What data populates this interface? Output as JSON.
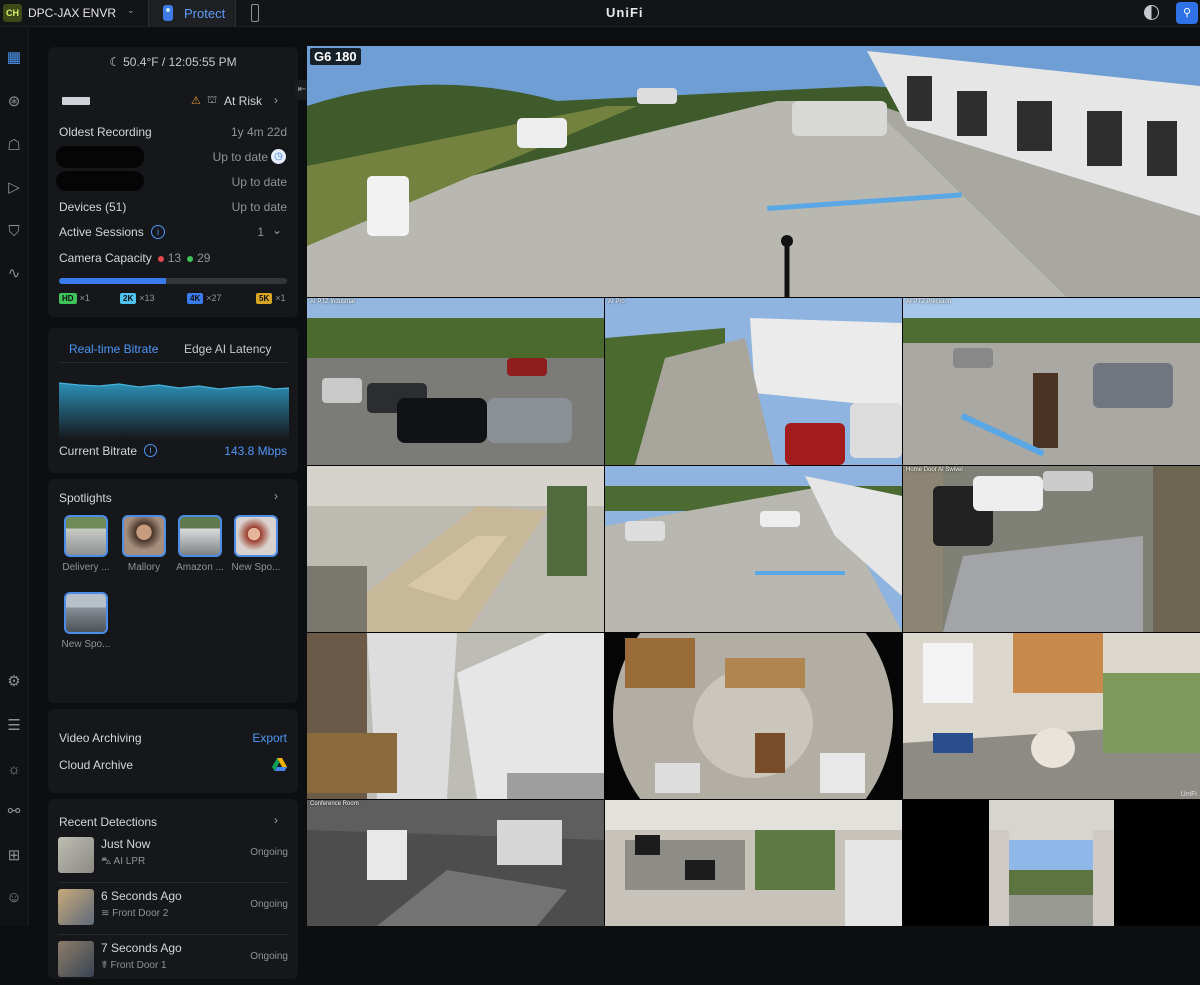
{
  "topbar": {
    "site_badge": "CH",
    "site_name": "DPC-JAX ENVR",
    "app_tab": "Protect",
    "logo": "UniFi"
  },
  "status": {
    "weather": "50.4°F / 12:05:55 PM",
    "risk_label": "At Risk",
    "rows": [
      {
        "label": "Oldest Recording",
        "value": "1y 4m 22d"
      },
      {
        "label": "",
        "value": "Up to date"
      },
      {
        "label": "",
        "value": "Up to date"
      },
      {
        "label": "Devices (51)",
        "value": "Up to date"
      },
      {
        "label": "Active Sessions",
        "value": "1"
      }
    ],
    "capacity_label": "Camera Capacity",
    "capacity_red": "13",
    "capacity_green": "29",
    "capacity_fraction": 0.47,
    "resolutions": [
      {
        "tag": "HD",
        "count": "×1",
        "color": "#3ec25a"
      },
      {
        "tag": "2K",
        "count": "×13",
        "color": "#4fc3f0"
      },
      {
        "tag": "4K",
        "count": "×27",
        "color": "#3a7bed"
      },
      {
        "tag": "5K",
        "count": "×1",
        "color": "#d9a520"
      }
    ]
  },
  "bitrate": {
    "tab_active": "Real-time Bitrate",
    "tab_other": "Edge AI Latency",
    "label": "Current Bitrate",
    "value": "143.8 Mbps"
  },
  "spotlights": {
    "title": "Spotlights",
    "items": [
      "Delivery ...",
      "Mallory",
      "Amazon ...",
      "New Spo...",
      "New Spo..."
    ]
  },
  "archive": {
    "video_archiving": "Video Archiving",
    "export": "Export",
    "cloud_archive": "Cloud Archive"
  },
  "detections": {
    "title": "Recent Detections",
    "items": [
      {
        "time": "Just Now",
        "source": "AI LPR",
        "status": "Ongoing"
      },
      {
        "time": "6 Seconds Ago",
        "source": "Front Door 2",
        "status": "Ongoing"
      },
      {
        "time": "7 Seconds Ago",
        "source": "Front Door 1",
        "status": "Ongoing"
      }
    ]
  },
  "cameras": {
    "main": "G6 180",
    "tiles": [
      "AI PTZ Industrial",
      "AI Pro",
      "AI PTZ Precision",
      "",
      "",
      "Home Door AI Swivel",
      "",
      "",
      "",
      "Conference Room",
      "",
      ""
    ],
    "watermark": "UniFi"
  }
}
